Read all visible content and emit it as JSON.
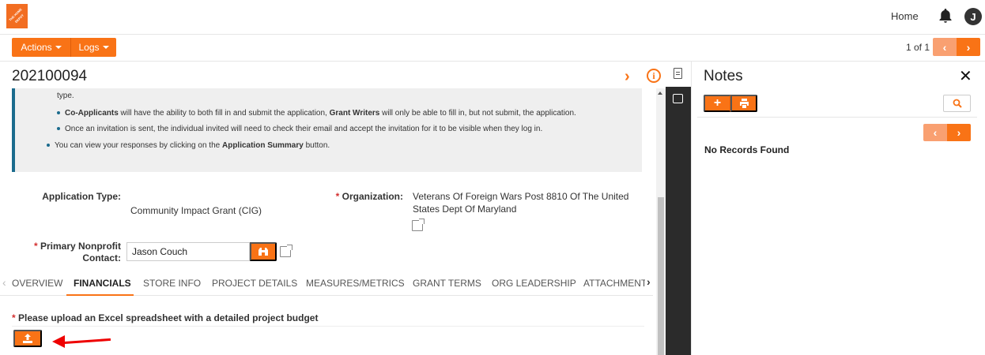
{
  "header": {
    "home_label": "Home",
    "avatar_initial": "J",
    "logo_text": "THE HOME DEPOT"
  },
  "toolbar": {
    "actions_label": "Actions",
    "logs_label": "Logs",
    "pager_text": "1 of 1"
  },
  "record": {
    "title": "202100094"
  },
  "info_box": {
    "line1": "type.",
    "line2_bold1": "Co-Applicants",
    "line2_mid": " will have the ability to both fill in and submit the application, ",
    "line2_bold2": "Grant Writers",
    "line2_end": " will only be able to fill in, but not submit, the application.",
    "line3": "Once an invitation is sent, the individual invited will need to check their email and accept the invitation for it to be visible when they log in.",
    "line4_start": "You can view your responses by clicking on the ",
    "line4_bold": "Application Summary",
    "line4_end": " button."
  },
  "fields": {
    "application_type_label": "Application Type:",
    "application_type_value": "Community Impact Grant (CIG)",
    "organization_label": "Organization:",
    "organization_value_line1": "Veterans Of Foreign Wars Post 8810 Of The United",
    "organization_value_line2": "States Dept Of Maryland",
    "primary_contact_label_line1": "Primary Nonprofit",
    "primary_contact_label_line2": "Contact:",
    "primary_contact_value": "Jason Couch",
    "required_marker": "*"
  },
  "tabs": [
    {
      "label": "OVERVIEW"
    },
    {
      "label": "FINANCIALS"
    },
    {
      "label": "STORE INFO"
    },
    {
      "label": "PROJECT DETAILS"
    },
    {
      "label": "MEASURES/METRICS"
    },
    {
      "label": "GRANT TERMS"
    },
    {
      "label": "ORG LEADERSHIP"
    },
    {
      "label": "ATTACHMENTS"
    }
  ],
  "financials": {
    "upload_label": "Please upload an Excel spreadsheet with a detailed project budget"
  },
  "notes": {
    "title": "Notes",
    "empty_text": "No Records Found"
  },
  "colors": {
    "accent": "#f97316",
    "info_border": "#1b6b8d",
    "annotation_arrow": "#e00000"
  }
}
